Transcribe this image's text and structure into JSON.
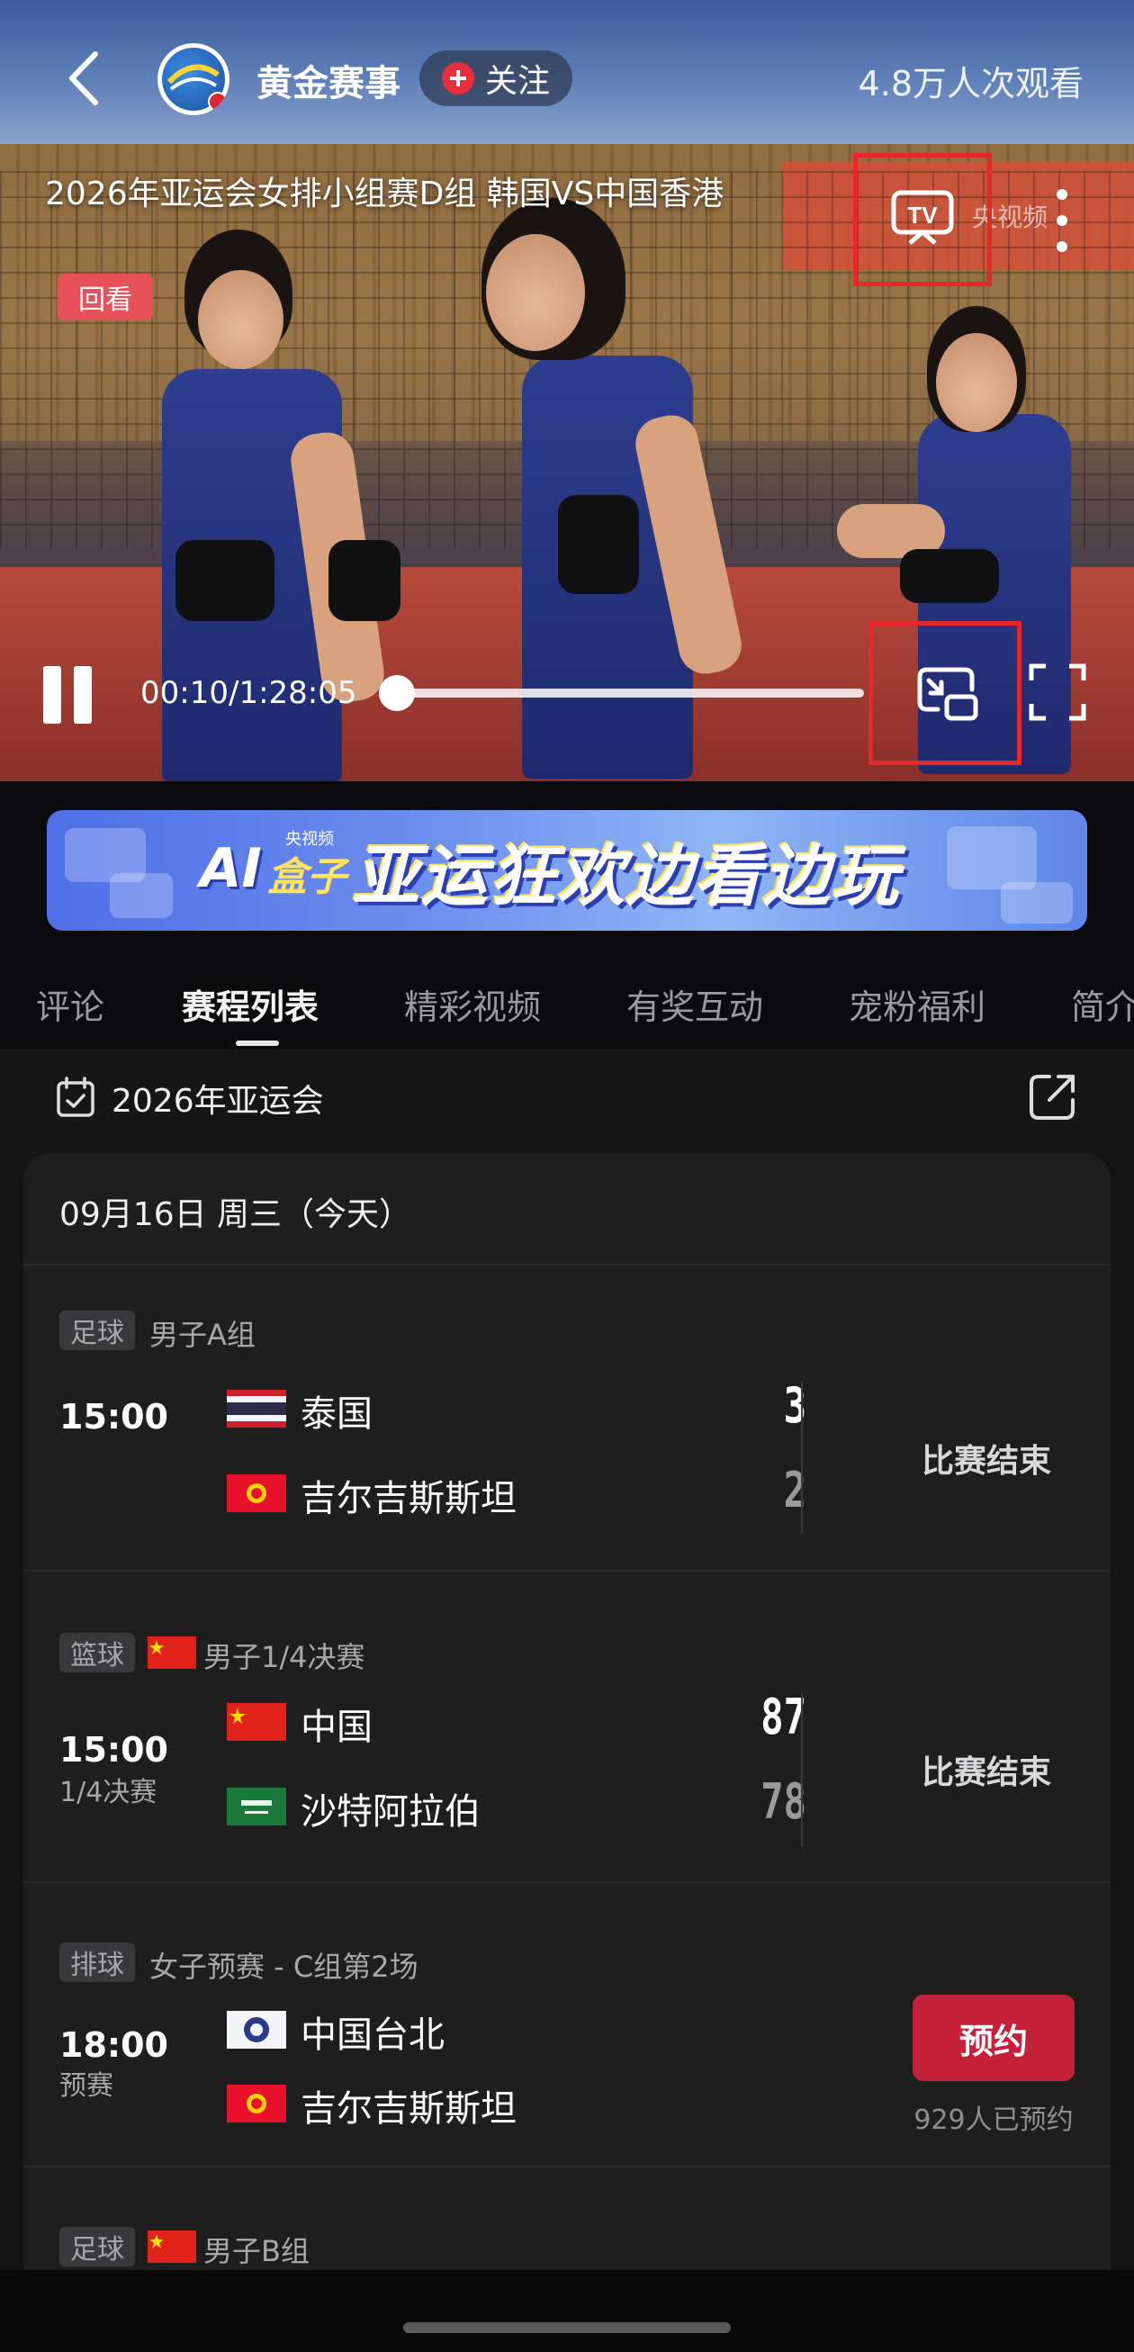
{
  "header": {
    "channel_name": "黄金赛事",
    "follow_label": "关注",
    "view_count": "4.8万人次观看",
    "logo_text": "黄金赛事"
  },
  "video": {
    "title": "2026年亚运会女排小组赛D组 韩国VS中国香港",
    "replay_tag": "回看",
    "watermark": "央视频",
    "time_display": "00:10/1:28:05",
    "progress_fraction": 0.002
  },
  "ad": {
    "ai_text": "AI",
    "box_text": "盒子",
    "small_text": "央视频",
    "main_text": "亚运狂欢边看边玩"
  },
  "tabs": [
    "评论",
    "赛程列表",
    "精彩视频",
    "有奖互动",
    "宠粉福利",
    "简介"
  ],
  "active_tab": "赛程列表",
  "schedule": {
    "competition": "2026年亚运会",
    "date": "09月16日 周三（今天）",
    "matches": [
      {
        "sport": "足球",
        "group": "男子A组",
        "time": "15:00",
        "sub": "",
        "team1": {
          "name": "泰国",
          "score": "3",
          "flag": "thailand-flag"
        },
        "team2": {
          "name": "吉尔吉斯斯坦",
          "score": "2",
          "flag": "kyrgyzstan-flag"
        },
        "status": "比赛结束"
      },
      {
        "sport": "篮球",
        "group": "男子1/4决赛",
        "time": "15:00",
        "sub": "1/4决赛",
        "team1": {
          "name": "中国",
          "score": "87",
          "flag": "china-flag"
        },
        "team2": {
          "name": "沙特阿拉伯",
          "score": "78",
          "flag": "saudi-flag"
        },
        "status": "比赛结束"
      },
      {
        "sport": "排球",
        "group": "女子预赛 - C组第2场",
        "time": "18:00",
        "sub": "预赛",
        "team1": {
          "name": "中国台北",
          "flag": "chinese-taipei-flag"
        },
        "team2": {
          "name": "吉尔吉斯斯坦",
          "flag": "kyrgyzstan-flag"
        },
        "reserve_label": "预约",
        "reserve_count": "929人已预约"
      },
      {
        "sport": "足球",
        "group": "男子B组"
      }
    ]
  },
  "colors": {
    "accent_red": "#c6213a",
    "highlight_red": "#e8272a",
    "background": "#141414",
    "card": "#1e1e1f"
  }
}
